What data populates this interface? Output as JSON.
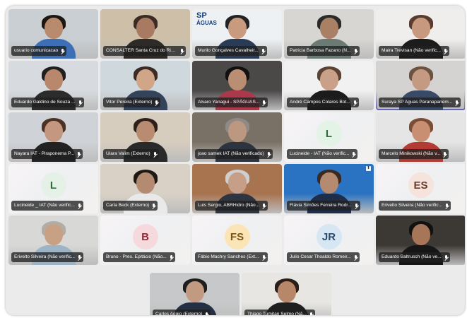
{
  "meeting": {
    "participants": [
      {
        "name": "usuario comunicacao",
        "type": "video",
        "bg": "#c9cfd3",
        "skin": "#b88a6e",
        "hair": "#1e1612",
        "shirt": "#3d6fb6"
      },
      {
        "name": "CONSALTER Santa Cruz do Rio ...",
        "type": "video",
        "bg": "#cdbfa8",
        "skin": "#a87a62",
        "hair": "#3a2c25",
        "shirt": "#2d2a28"
      },
      {
        "name": "Murilo Gonçalves Cavalheir...",
        "type": "video",
        "bg": "#eef1f4",
        "skin": "#c89a7e",
        "hair": "#222222",
        "shirt": "#2a3b55",
        "logo": {
          "line1": "SP",
          "line2": "ÁGUAS"
        }
      },
      {
        "name": "Patricia Barbosa Fazano (N...",
        "type": "video",
        "bg": "#d8d6d2",
        "skin": "#a98066",
        "hair": "#2a2a2a",
        "shirt": "#6b7a72"
      },
      {
        "name": "Maira Trevisan (Não verific...",
        "type": "video",
        "bg": "#f0eeec",
        "skin": "#c79a7f",
        "hair": "#5a3c2e",
        "shirt": "#1c1c1c"
      },
      {
        "name": "Eduardo Galdino de Souza ...",
        "type": "video",
        "bg": "#d7dbe0",
        "skin": "#b9876b",
        "hair": "#1f1f1f",
        "shirt": "#2c2c2c"
      },
      {
        "name": "Vitor Pereira (Externo)",
        "type": "video",
        "bg": "#cfd8dd",
        "skin": "#d1a588",
        "hair": "#3b2b22",
        "shirt": "#33435a"
      },
      {
        "name": "Alvaro Yanagui - SPÁGUAS...",
        "type": "video",
        "bg": "#4b4848",
        "skin": "#b98e72",
        "hair": "#111111",
        "shirt": "#a9394b"
      },
      {
        "name": "André Campos Colares Bot...",
        "type": "video",
        "bg": "#f1f1f1",
        "skin": "#caa089",
        "hair": "#5a4333",
        "shirt": "#1b1b1b"
      },
      {
        "name": "Suraya SP Aguas Paranapanem...",
        "type": "video",
        "active": true,
        "bg": "#d4d3d1",
        "skin": "#c59a82",
        "hair": "#6c5240",
        "shirt": "#394a66"
      },
      {
        "name": "Nayara IAT - Piraponema P...",
        "type": "video",
        "bg": "#cfd2d6",
        "skin": "#c49880",
        "hair": "#4b3225",
        "shirt": "#222222"
      },
      {
        "name": "Uiara Valim (Externo)",
        "type": "video",
        "bg": "#d7cdbf",
        "skin": "#b98b70",
        "hair": "#2e211b",
        "shirt": "#2a2a2a"
      },
      {
        "name": "joao samek IAT (Não verificado)",
        "type": "video",
        "bg": "#7a7166",
        "skin": "#bd9880",
        "hair": "#8f8a86",
        "shirt": "#2d3440"
      },
      {
        "name": "Lucineide - IAT (Não verific...",
        "type": "avatar",
        "initials": "L",
        "avatar_bg": "#e3f3e6",
        "avatar_fg": "#2f6b3c"
      },
      {
        "name": "Marcelo Minikowski (Não v...",
        "type": "video",
        "bg": "#e5e5e5",
        "skin": "#c98f72",
        "hair": "#7b4d36",
        "shirt": "#b23b33"
      },
      {
        "name": "Lucineide _ IAT (Não verific...",
        "type": "avatar",
        "initials": "L",
        "avatar_bg": "#e5f1e6",
        "avatar_fg": "#2f6b3c"
      },
      {
        "name": "Carla Beck (Externo)",
        "type": "video",
        "bg": "#d9d1c6",
        "skin": "#b48a71",
        "hair": "#1f1915",
        "shirt": "#e9e9e9"
      },
      {
        "name": "Luis Sergio, ABRHidro (Não...",
        "type": "video",
        "bg": "#a8734f",
        "skin": "#c79f88",
        "hair": "#cfcfcf",
        "shirt": "#2f3540"
      },
      {
        "name": "Flávia Simões Ferreira Rodr...",
        "type": "video",
        "pinned": true,
        "bg": "#2a73c2",
        "skin": "#b48b71",
        "hair": "#3a2a22",
        "shirt": "#1e2e4a"
      },
      {
        "name": "Erivelto Silveira (Não verific...",
        "type": "avatar",
        "initials": "ES",
        "avatar_bg": "#f5e3dc",
        "avatar_fg": "#6b3c2b"
      },
      {
        "name": "Erivelto Silveira (Não verific...",
        "type": "video",
        "bg": "#d8d8d6",
        "skin": "#c8a083",
        "hair": "#b3aca4",
        "shirt": "#9db3c6"
      },
      {
        "name": "Bruno - Pres. Epitácio (Não...",
        "type": "avatar",
        "initials": "B",
        "avatar_bg": "#f6d9dc",
        "avatar_fg": "#8f2a37"
      },
      {
        "name": "Fábio Machry Sanches (Ext...",
        "type": "avatar",
        "initials": "FS",
        "avatar_bg": "#fbe5b7",
        "avatar_fg": "#7a5411"
      },
      {
        "name": "Julio Cesar Thoaldo Romeir...",
        "type": "avatar",
        "initials": "JR",
        "avatar_bg": "#d7e6f3",
        "avatar_fg": "#2b4a6d"
      },
      {
        "name": "Eduardo Baltrusch (Não ve...",
        "type": "video",
        "bg": "#3c3833",
        "skin": "#a77658",
        "hair": "#111111",
        "shirt": "#161616"
      }
    ],
    "bottom_row": [
      {
        "name": "Carlos Aggio (Externo)",
        "type": "video",
        "bg": "#c6c8c9",
        "skin": "#c29a82",
        "hair": "#1e1e1e",
        "shirt": "#233044"
      },
      {
        "name": "Thiago Tumitan Selmo (Nã...",
        "type": "video",
        "bg": "#e7e6e2",
        "skin": "#b88769",
        "hair": "#2a1e18",
        "shirt": "#1f1f1f"
      }
    ],
    "icons": {
      "mic": "mic-icon",
      "pin": "pin-icon"
    }
  }
}
